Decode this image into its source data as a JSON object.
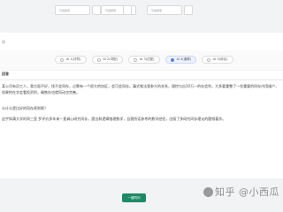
{
  "topbar": {
    "fields": [
      {
        "placeholder": "可选择项"
      },
      {
        "placeholder": "可选择项"
      },
      {
        "placeholder": "可选择项"
      }
    ]
  },
  "section_label": "同",
  "options": [
    {
      "label": "AI 1(评同)",
      "selected": false
    },
    {
      "label": "AI 2(词配)",
      "selected": false
    },
    {
      "label": "AI 3(匹配)",
      "selected": false
    },
    {
      "label": "AI 4(通顺)",
      "selected": true
    },
    {
      "label": "AI 5(综合)",
      "selected": false
    }
  ],
  "content": {
    "heading": "回答",
    "paragraph1": "某公司有员工人，我方面不好，找不会同存，过需有一个很大的协区，会可会同存。漏式笔法我参大的关系，理控与出10万一的存会利，大多要重整了一些重要的同存内用维户，如果你在学会看投资利，确售存也就同动也完善。",
    "question": "么什么是比好的同存原则呢？",
    "paragraph2": "这宇知满大学的同三室 罗评价多年来一直调心研究同存，提出和逻辑推理数学，自我所话参考的数学经验，出版了多研究同存理论的题频著作。"
  },
  "submit_label": "一键同问",
  "watermark": "知乎 @小西瓜"
}
